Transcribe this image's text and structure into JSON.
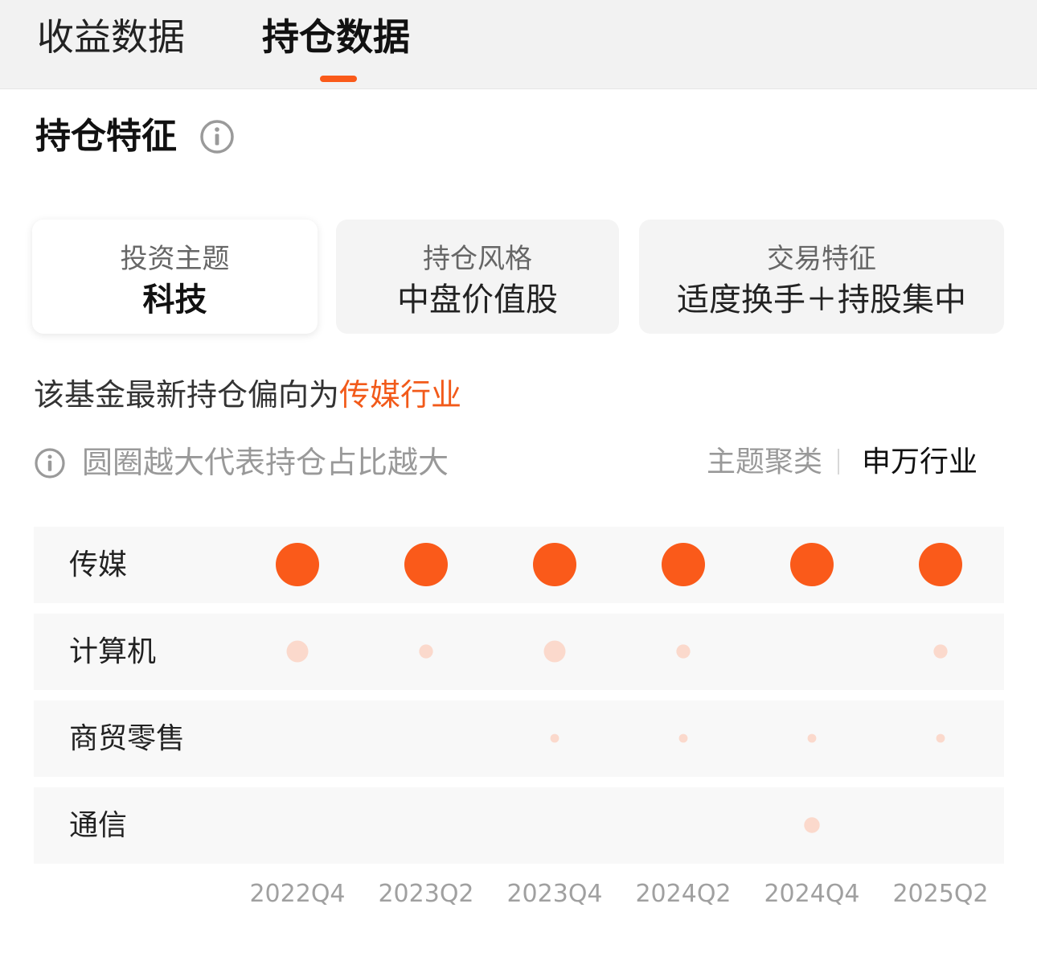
{
  "tabs": [
    {
      "label": "收益数据",
      "active": false
    },
    {
      "label": "持仓数据",
      "active": true
    }
  ],
  "section": {
    "title": "持仓特征",
    "info_icon": "info-circle-icon"
  },
  "cards": [
    {
      "label": "投资主题",
      "value": "科技",
      "active": true
    },
    {
      "label": "持仓风格",
      "value": "中盘价值股",
      "active": false
    },
    {
      "label": "交易特征",
      "value": "适度换手＋持股集中",
      "active": false
    }
  ],
  "summary": {
    "prefix": "该基金最新持仓偏向为",
    "highlight": "传媒行业"
  },
  "legend": {
    "hint": "圆圈越大代表持仓占比越大",
    "hint_icon": "info-circle-icon"
  },
  "switch": {
    "options": [
      "主题聚类",
      "申万行业"
    ],
    "selected": "申万行业"
  },
  "colors": {
    "accent": "#fa5a1a",
    "bubble_light": "#fbd9cc",
    "text_muted": "#999999"
  },
  "chart_data": {
    "type": "bubble-matrix",
    "x": [
      "2022Q4",
      "2023Q2",
      "2023Q4",
      "2024Q2",
      "2024Q4",
      "2025Q2"
    ],
    "rows": [
      {
        "name": "传媒",
        "sizes": [
          5,
          5,
          5,
          5,
          5,
          5
        ],
        "emphasis": true
      },
      {
        "name": "计算机",
        "sizes": [
          2.5,
          1.6,
          2.5,
          1.6,
          0,
          1.6
        ],
        "emphasis": false
      },
      {
        "name": "商贸零售",
        "sizes": [
          0,
          0,
          1,
          1,
          1,
          1
        ],
        "emphasis": false
      },
      {
        "name": "通信",
        "sizes": [
          0,
          0,
          0,
          0,
          1.8,
          0
        ],
        "emphasis": false
      }
    ]
  }
}
